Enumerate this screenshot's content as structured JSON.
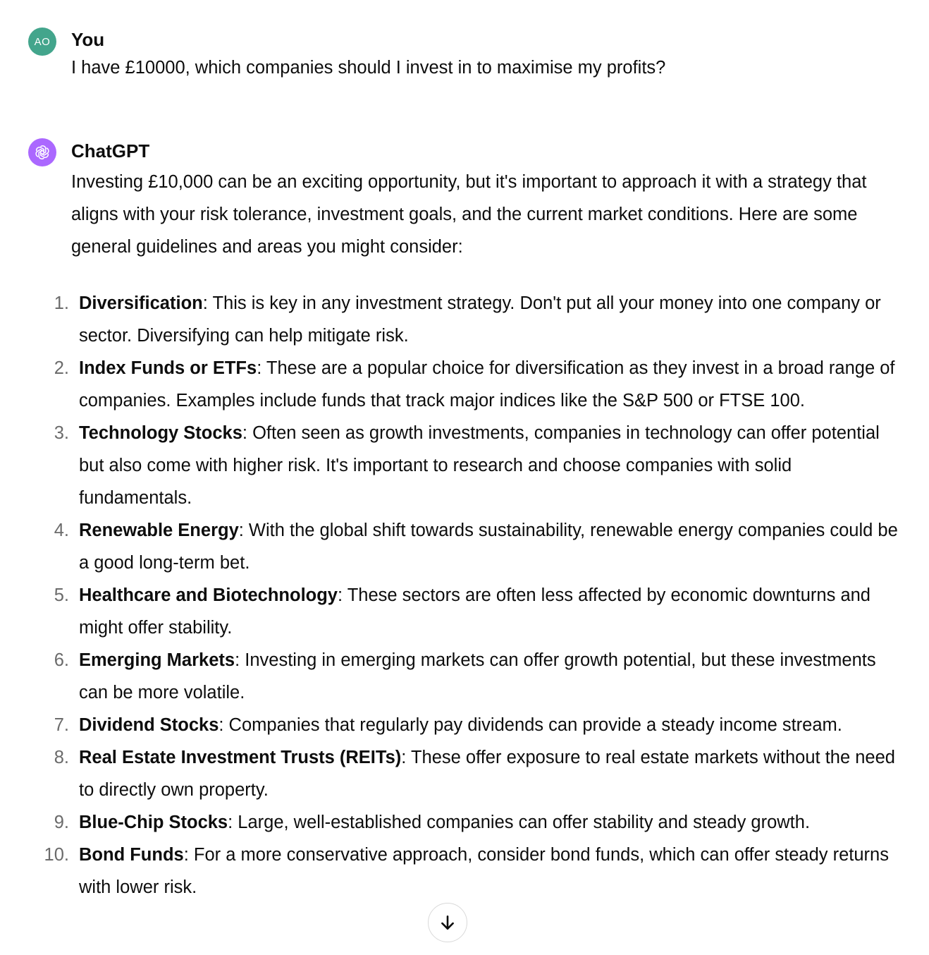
{
  "conversation": {
    "user_message": {
      "avatar_initials": "AO",
      "avatar_color": "#43a58c",
      "author": "You",
      "text": "I have £10000, which companies should I invest in to maximise my profits?"
    },
    "assistant_message": {
      "avatar_icon": "openai-logo-icon",
      "avatar_color": "#ab68ff",
      "author": "ChatGPT",
      "intro": "Investing £10,000 can be an exciting opportunity, but it's important to approach it with a strategy that aligns with your risk tolerance, investment goals, and the current market conditions. Here are some general guidelines and areas you might consider:",
      "points": [
        {
          "num": "1.",
          "title": "Diversification",
          "text": ": This is key in any investment strategy. Don't put all your money into one company or sector. Diversifying can help mitigate risk."
        },
        {
          "num": "2.",
          "title": "Index Funds or ETFs",
          "text": ": These are a popular choice for diversification as they invest in a broad range of companies. Examples include funds that track major indices like the S&P 500 or FTSE 100."
        },
        {
          "num": "3.",
          "title": "Technology Stocks",
          "text": ": Often seen as growth investments, companies in technology can offer potential but also come with higher risk. It's important to research and choose companies with solid fundamentals."
        },
        {
          "num": "4.",
          "title": "Renewable Energy",
          "text": ": With the global shift towards sustainability, renewable energy companies could be a good long-term bet."
        },
        {
          "num": "5.",
          "title": "Healthcare and Biotechnology",
          "text": ": These sectors are often less affected by economic downturns and might offer stability."
        },
        {
          "num": "6.",
          "title": "Emerging Markets",
          "text": ": Investing in emerging markets can offer growth potential, but these investments can be more volatile."
        },
        {
          "num": "7.",
          "title": "Dividend Stocks",
          "text": ": Companies that regularly pay dividends can provide a steady income stream."
        },
        {
          "num": "8.",
          "title": "Real Estate Investment Trusts (REITs)",
          "text": ": These offer exposure to real estate markets without the need to directly own property."
        },
        {
          "num": "9.",
          "title": "Blue-Chip Stocks",
          "text": ": Large, well-established companies can offer stability and steady growth."
        },
        {
          "num": "10.",
          "title": "Bond Funds",
          "text": ": For a more conservative approach, consider bond funds, which can offer steady returns with lower risk."
        }
      ]
    }
  },
  "controls": {
    "scroll_down_icon": "arrow-down-icon"
  }
}
